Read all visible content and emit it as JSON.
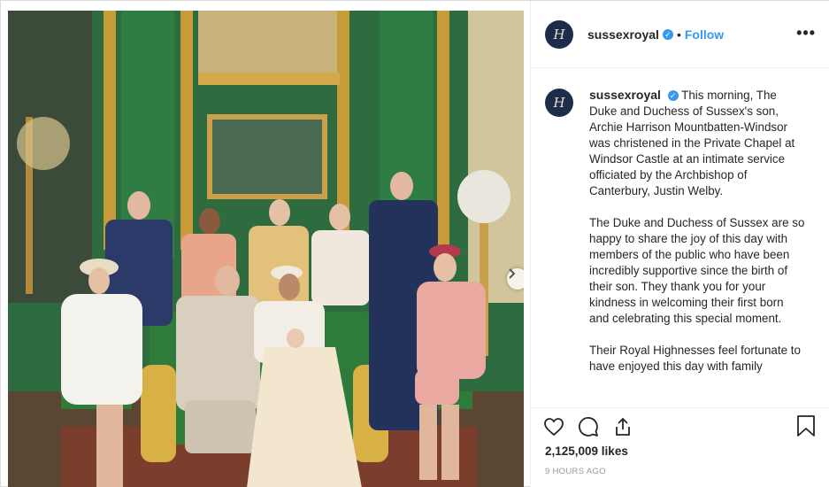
{
  "post": {
    "username": "sussexroyal",
    "follow_label": "Follow",
    "separator": "•",
    "more_label": "•••",
    "avatar_initial": "H",
    "caption": {
      "username": "sussexroyal",
      "paragraphs": [
        "This morning, The Duke and Duchess of Sussex's son, Archie Harrison Mountbatten-Windsor was christened in the Private Chapel at Windsor Castle at an intimate service officiated by the Archbishop of Canterbury, Justin Welby.",
        "The Duke and Duchess of Sussex are so happy to share the joy of this day with members of the public who have been incredibly supportive since the birth of their son. They thank you for your kindness in welcoming their first born and celebrating this special moment.",
        "Their Royal Highnesses feel fortunate to have enjoyed this day with family"
      ]
    },
    "likes": "2,125,009 likes",
    "time": "9 HOURS AGO",
    "photo_alt": "Royal family christening portrait",
    "icons": {
      "like": "heart-icon",
      "comment": "comment-icon",
      "share": "share-icon",
      "save": "bookmark-icon",
      "verified": "verified-badge-icon",
      "carousel": "chevron-right-icon"
    },
    "colors": {
      "link": "#3897f0",
      "text": "#262626",
      "muted": "#999999",
      "avatar_bg": "#1e2c4c"
    }
  }
}
